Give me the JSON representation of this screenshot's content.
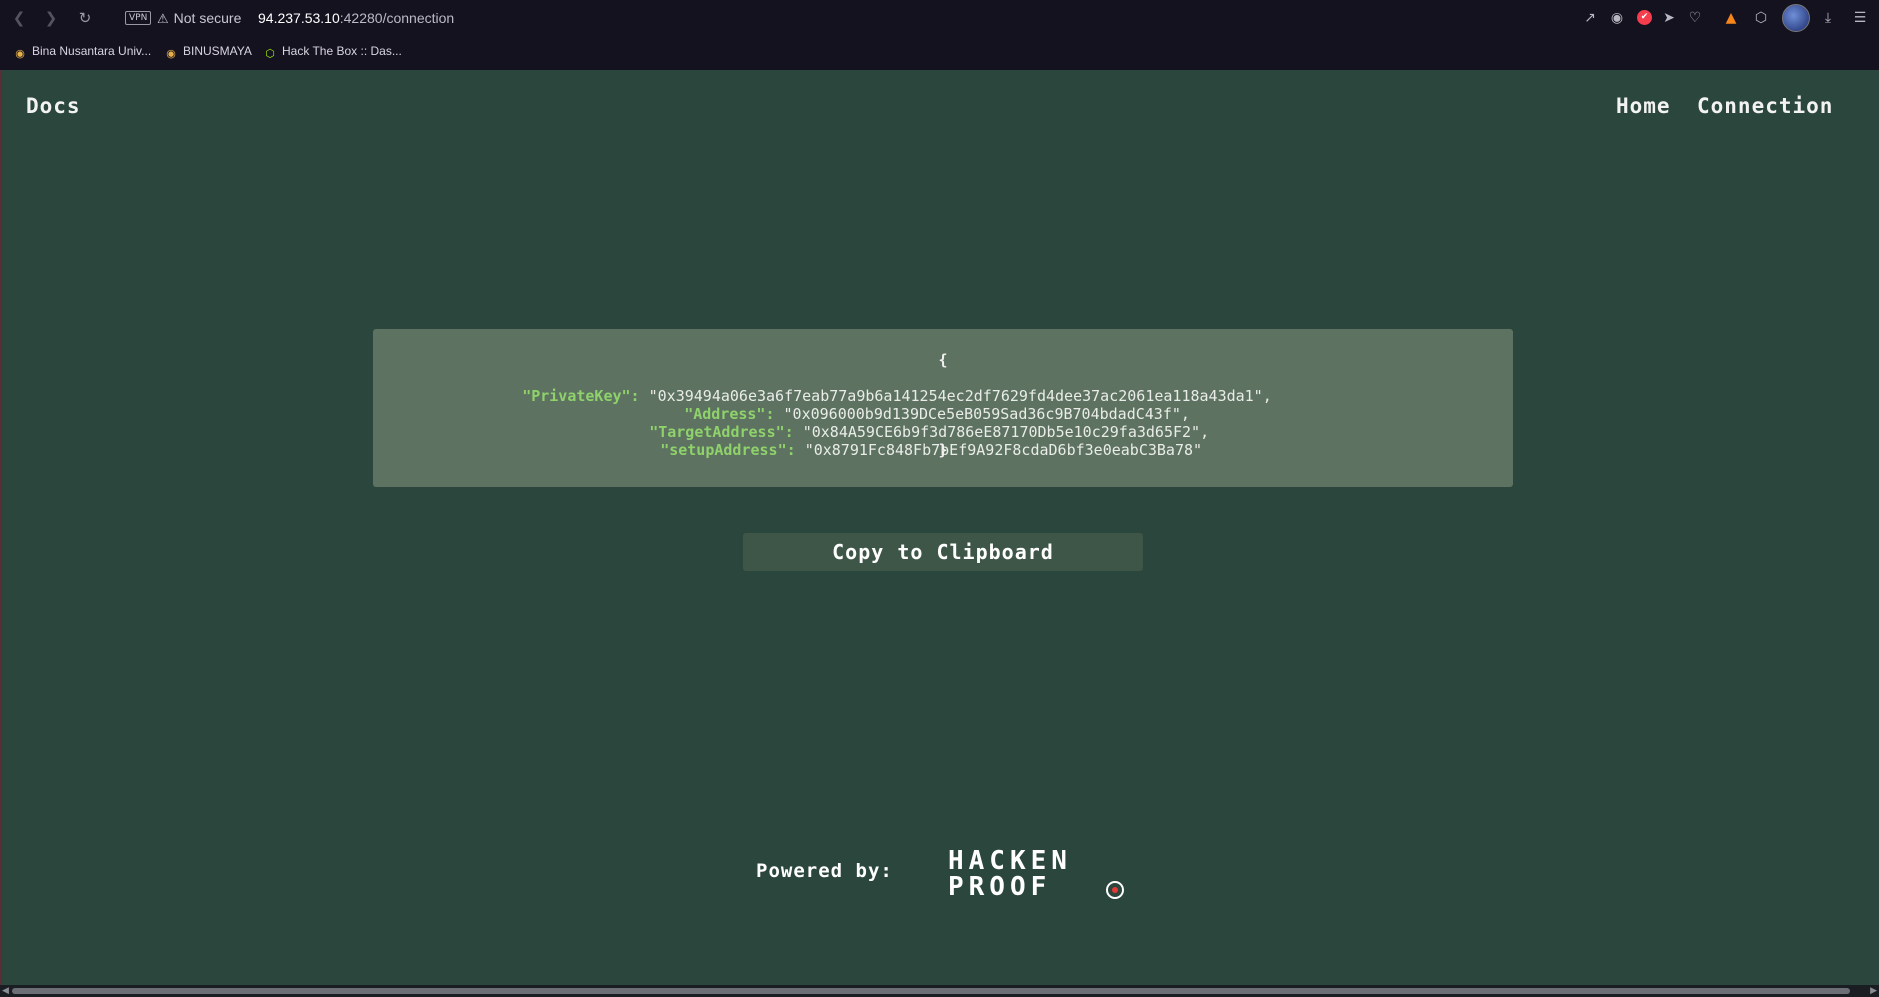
{
  "browser": {
    "vpn_label": "VPN",
    "security_label": "Not secure",
    "url_host": "94.237.53.10",
    "url_path": ":42280/connection",
    "bookmarks": [
      {
        "label": "Bina Nusantara Univ..."
      },
      {
        "label": "BINUSMAYA"
      },
      {
        "label": "Hack The Box :: Das..."
      }
    ]
  },
  "nav": {
    "docs": "Docs",
    "home": "Home",
    "connection": "Connection"
  },
  "connection": {
    "open_brace": "{",
    "close_brace": "}",
    "fields": [
      {
        "key": "\"PrivateKey\":",
        "value": "\"0x39494a06e3a6f7eab77a9b6a141254ec2df7629fd4dee37ac2061ea118a43da1\","
      },
      {
        "key": "\"Address\":",
        "value": "\"0x096000b9d139DCe5eB059Sad36c9B704bdadC43f\","
      },
      {
        "key": "\"TargetAddress\":",
        "value": "\"0x84A59CE6b9f3d786eE87170Db5e10c29fa3d65F2\","
      },
      {
        "key": "\"setupAddress\":",
        "value": "\"0x8791Fc848Fb7bEf9A92F8cdaD6bf3e0eabC3Ba78\""
      }
    ]
  },
  "copy_button_label": "Copy to Clipboard",
  "footer": {
    "powered_by": "Powered by:",
    "logo_line1": "HACKEN",
    "logo_line2": "PROOF"
  }
}
